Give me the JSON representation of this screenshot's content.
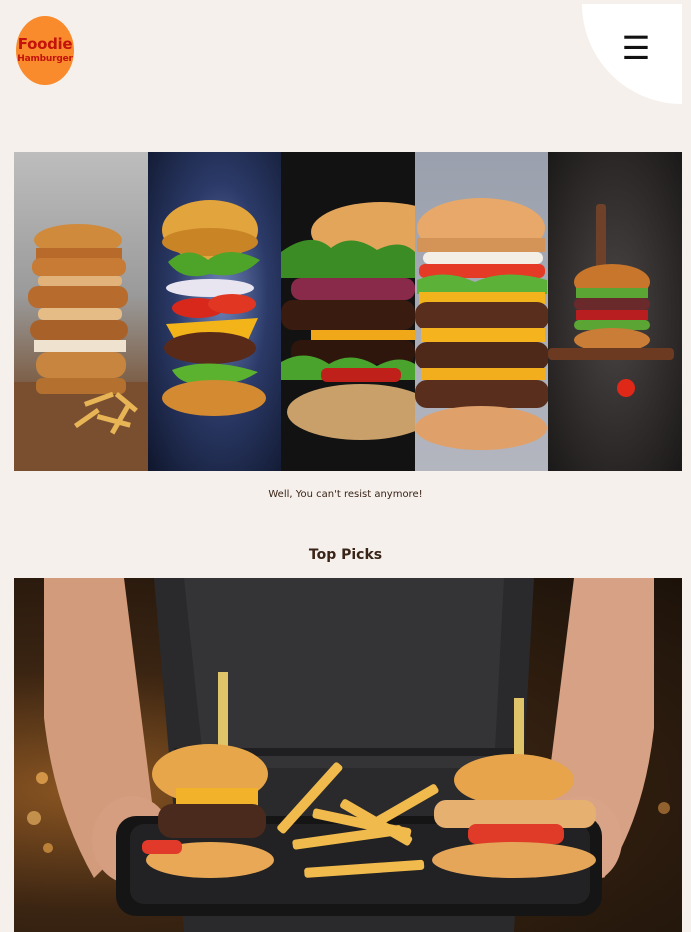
{
  "header": {
    "logo_line1": "Foodie",
    "logo_line2": "Hamburger",
    "menu_icon": "☰"
  },
  "hero": {
    "caption": "Well, You can't resist anymore!"
  },
  "top_picks": {
    "title": "Top Picks"
  },
  "colors": {
    "background": "#f5f0eb",
    "logo_bg": "#f98b2c",
    "logo_text": "#c4120c",
    "text": "#3a2418"
  }
}
